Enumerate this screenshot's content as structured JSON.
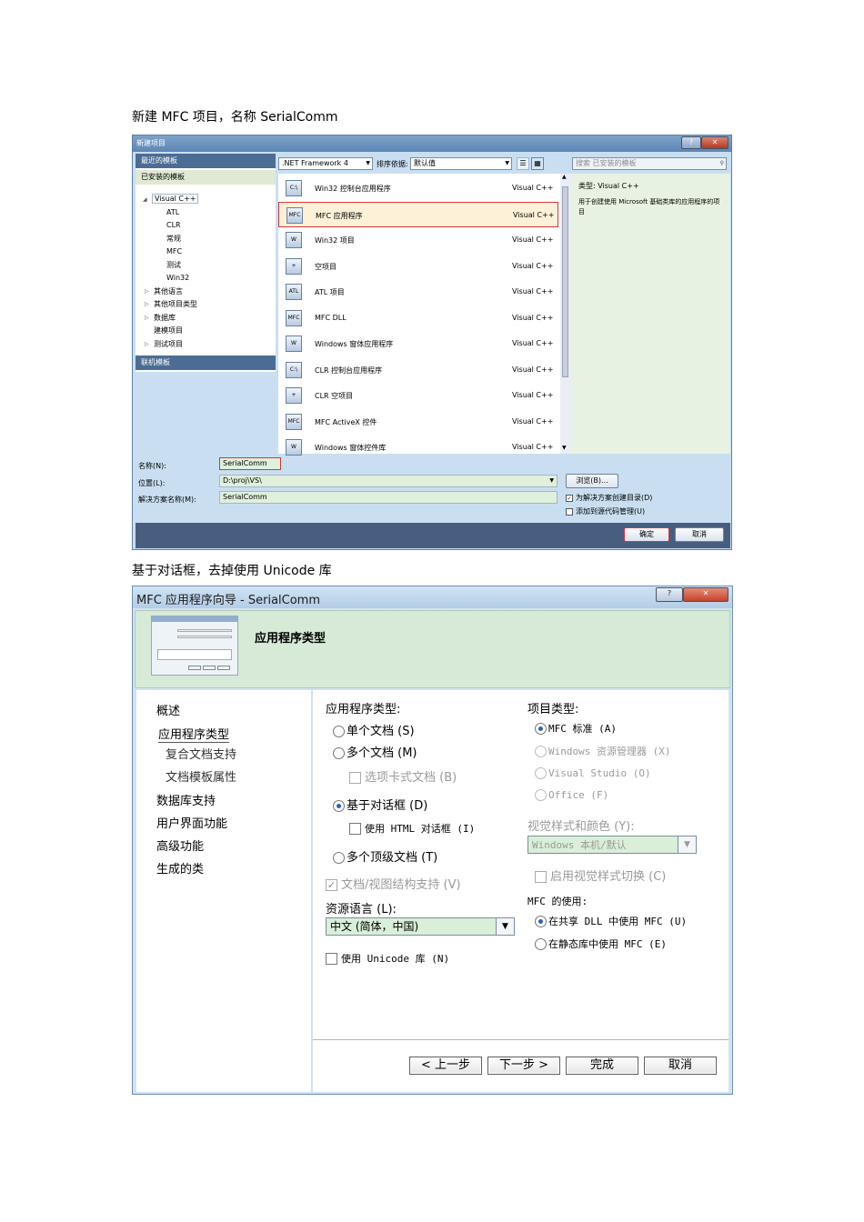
{
  "caption1": "新建 MFC 项目，名称 SerialComm",
  "caption2": "基于对话框，去掉使用 Unicode 库",
  "dialog1": {
    "title": "新建项目",
    "help_btn": "?",
    "close_btn": "✕",
    "sidebar": {
      "recent": "最近的模板",
      "installed": "已安装的模板",
      "root": "Visual C++",
      "items": [
        "ATL",
        "CLR",
        "常规",
        "MFC",
        "测试",
        "Win32"
      ],
      "groups": [
        "其他语言",
        "其他项目类型",
        "数据库",
        "建模项目",
        "测试项目"
      ],
      "online": "联机模板"
    },
    "toolbar": {
      "framework": ".NET Framework 4",
      "sort_label": "排序依据:",
      "sort_value": "默认值",
      "search_placeholder": "搜索 已安装的模板"
    },
    "templates": [
      {
        "name": "Win32 控制台应用程序",
        "lang": "Visual C++",
        "icon": "C:\\"
      },
      {
        "name": "MFC 应用程序",
        "lang": "Visual C++",
        "icon": "MFC",
        "selected": true
      },
      {
        "name": "Win32 项目",
        "lang": "Visual C++",
        "icon": "W"
      },
      {
        "name": "空项目",
        "lang": "Visual C++",
        "icon": "+"
      },
      {
        "name": "ATL 项目",
        "lang": "Visual C++",
        "icon": "ATL"
      },
      {
        "name": "MFC DLL",
        "lang": "Visual C++",
        "icon": "MFC"
      },
      {
        "name": "Windows 窗体应用程序",
        "lang": "Visual C++",
        "icon": "W"
      },
      {
        "name": "CLR 控制台应用程序",
        "lang": "Visual C++",
        "icon": "C:\\"
      },
      {
        "name": "CLR 空项目",
        "lang": "Visual C++",
        "icon": "+"
      },
      {
        "name": "MFC ActiveX 控件",
        "lang": "Visual C++",
        "icon": "MFC"
      },
      {
        "name": "Windows 窗体控件库",
        "lang": "Visual C++",
        "icon": "W"
      }
    ],
    "info": {
      "type": "类型: Visual C++",
      "desc": "用于创建使用 Microsoft 基础类库的应用程序的项目"
    },
    "fields": {
      "name_label": "名称(N):",
      "name_value": "SerialComm",
      "location_label": "位置(L):",
      "location_value": "D:\\proj\\VS\\",
      "solution_label": "解决方案名称(M):",
      "solution_value": "SerialComm",
      "browse": "浏览(B)...",
      "create_dir": "为解决方案创建目录(D)",
      "source_control": "添加到源代码管理(U)"
    },
    "ok": "确定",
    "cancel": "取消"
  },
  "dialog2": {
    "title": "MFC 应用程序向导 - SerialComm",
    "help_btn": "?",
    "close_btn": "✕",
    "header_title": "应用程序类型",
    "nav": [
      "概述",
      "应用程序类型",
      "复合文档支持",
      "文档模板属性",
      "数据库支持",
      "用户界面功能",
      "高级功能",
      "生成的类"
    ],
    "app_type_label": "应用程序类型:",
    "app_types": {
      "single": "单个文档 (S)",
      "multi": "多个文档 (M)",
      "tabbed": "选项卡式文档 (B)",
      "dialog": "基于对话框 (D)",
      "html": "使用 HTML 对话框 (I)",
      "toplevel": "多个顶级文档 (T)",
      "docview": "文档/视图结构支持 (V)"
    },
    "res_lang_label": "资源语言 (L):",
    "res_lang_value": "中文 (简体，中国)",
    "unicode": "使用 Unicode 库 (N)",
    "proj_type_label": "项目类型:",
    "proj_types": {
      "mfc": "MFC 标准 (A)",
      "explorer": "Windows 资源管理器 (X)",
      "vs": "Visual Studio (O)",
      "office": "Office (F)"
    },
    "visual_style_label": "视觉样式和颜色 (Y):",
    "visual_style_value": "Windows 本机/默认",
    "visual_switch": "启用视觉样式切换 (C)",
    "mfc_use_label": "MFC 的使用:",
    "mfc_shared": "在共享 DLL 中使用 MFC (U)",
    "mfc_static": "在静态库中使用 MFC (E)",
    "buttons": {
      "prev": "< 上一步",
      "next": "下一步 >",
      "finish": "完成",
      "cancel": "取消"
    }
  }
}
